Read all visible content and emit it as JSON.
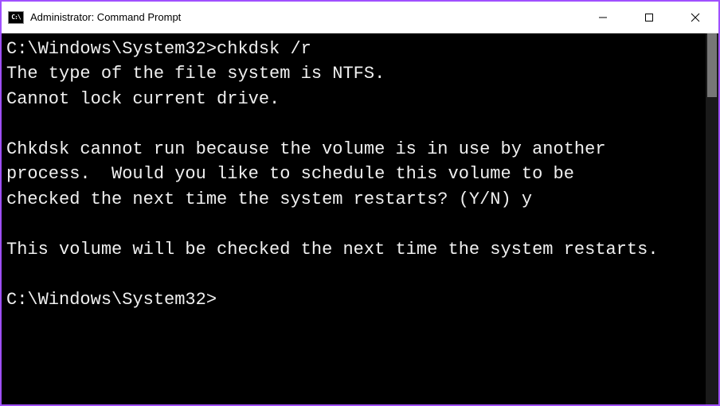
{
  "window": {
    "title": "Administrator: Command Prompt",
    "icon_label": "C:\\"
  },
  "terminal": {
    "prompt1_path": "C:\\Windows\\System32>",
    "prompt1_command": "chkdsk /r",
    "output_line1": "The type of the file system is NTFS.",
    "output_line2": "Cannot lock current drive.",
    "blank1": "",
    "output_line3": "Chkdsk cannot run because the volume is in use by another",
    "output_line4": "process.  Would you like to schedule this volume to be",
    "output_line5": "checked the next time the system restarts? (Y/N) y",
    "blank2": "",
    "output_line6": "This volume will be checked the next time the system restarts.",
    "blank3": "",
    "prompt2_path": "C:\\Windows\\System32>"
  }
}
